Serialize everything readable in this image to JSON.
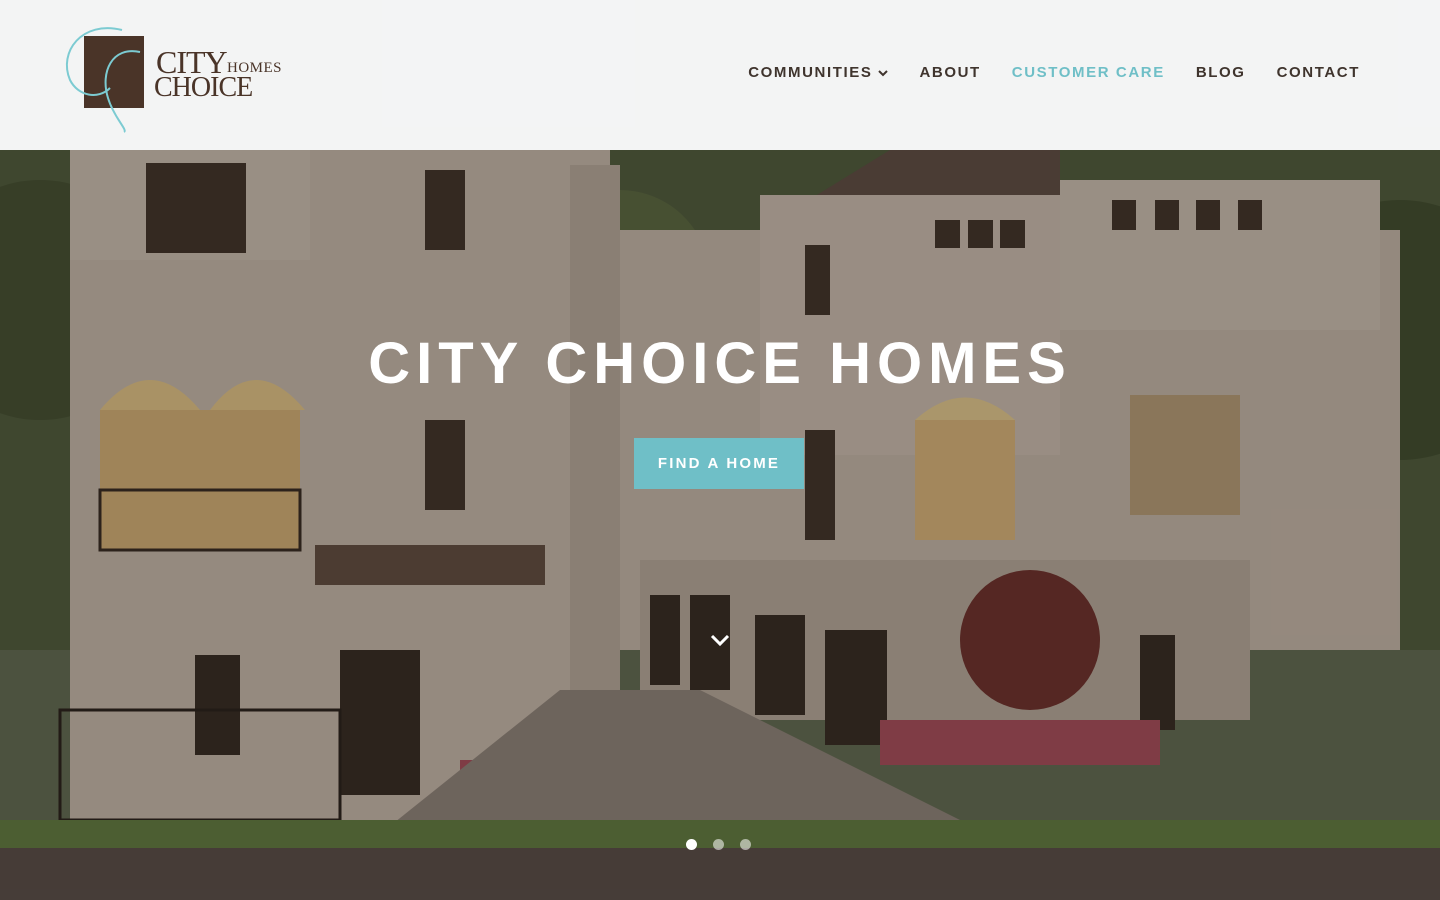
{
  "brand": {
    "logo_words": {
      "city": "CITY",
      "homes": "HOMES",
      "choice": "CHOICE"
    },
    "colors": {
      "accent": "#6fbfc7",
      "text_dark": "#3f342d",
      "logo_brown": "#4a3428"
    }
  },
  "nav": {
    "items": [
      {
        "label": "COMMUNITIES",
        "has_dropdown": true,
        "active": false,
        "icon": "chevron-down-icon"
      },
      {
        "label": "ABOUT",
        "has_dropdown": false,
        "active": false
      },
      {
        "label": "CUSTOMER CARE",
        "has_dropdown": false,
        "active": true
      },
      {
        "label": "BLOG",
        "has_dropdown": false,
        "active": false
      },
      {
        "label": "CONTACT",
        "has_dropdown": false,
        "active": false
      }
    ]
  },
  "hero": {
    "title": "CITY CHOICE HOMES",
    "cta_label": "FIND A HOME",
    "scroll_icon": "chevron-down-icon",
    "slides": {
      "count": 3,
      "active_index": 0
    }
  }
}
